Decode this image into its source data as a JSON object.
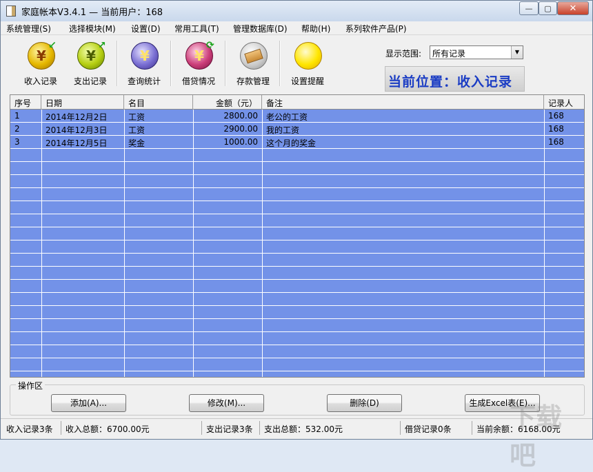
{
  "window": {
    "title": "家庭帐本V3.4.1  —  当前用户：168",
    "controls": {
      "minimize": "—",
      "maximize": "▢",
      "close": "✕"
    }
  },
  "menu": [
    "系统管理(S)",
    "选择模块(M)",
    "设置(D)",
    "常用工具(T)",
    "管理数据库(D)",
    "帮助(H)",
    "系列软件产品(P)"
  ],
  "toolbar": {
    "tools": [
      {
        "label": "收入记录",
        "icon": "income-coin-icon",
        "glyph": "¥"
      },
      {
        "label": "支出记录",
        "icon": "expense-coin-icon",
        "glyph": "¥"
      },
      {
        "label": "查询统计",
        "icon": "query-stats-icon",
        "glyph": "¥"
      },
      {
        "label": "借贷情况",
        "icon": "loan-icon",
        "glyph": "¥"
      },
      {
        "label": "存款管理",
        "icon": "deposit-card-icon",
        "glyph": ""
      },
      {
        "label": "设置提醒",
        "icon": "reminder-bulb-icon",
        "glyph": ""
      }
    ],
    "range_label": "显示范围:",
    "range_value": "所有记录",
    "position_text": "当前位置：收入记录"
  },
  "table": {
    "headers": [
      "序号",
      "日期",
      "名目",
      "金额（元）",
      "备注",
      "记录人"
    ],
    "rows": [
      [
        "1",
        "2014年12月2日",
        "工资",
        "2800.00",
        "老公的工资",
        "168"
      ],
      [
        "2",
        "2014年12月3日",
        "工资",
        "2900.00",
        "我的工资",
        "168"
      ],
      [
        "3",
        "2014年12月5日",
        "奖金",
        "1000.00",
        "这个月的奖金",
        "168"
      ]
    ]
  },
  "ops": {
    "title": "操作区",
    "buttons": [
      "添加(A)...",
      "修改(M)...",
      "删除(D)",
      "生成Excel表(E)..."
    ]
  },
  "status": {
    "income_count": "收入记录3条",
    "income_total": "收入总额：6700.00元",
    "expense_count": "支出记录3条",
    "expense_total": "支出总额：532.00元",
    "loan_count": "借贷记录0条",
    "balance": "当前余额：6168.00元"
  },
  "watermark": "下载吧",
  "colors": {
    "grid_bg": "#7392e8",
    "position_text": "#1a3cc4"
  }
}
